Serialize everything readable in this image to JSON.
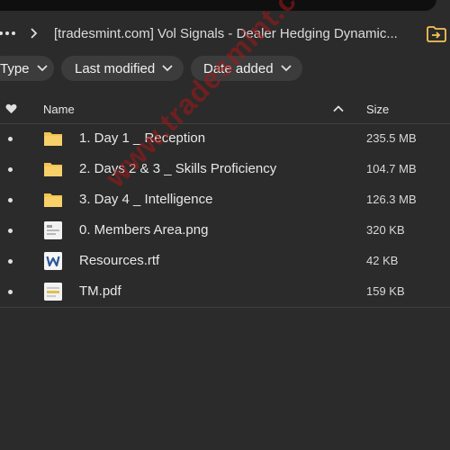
{
  "breadcrumb": {
    "title": "[tradesmint.com] Vol Signals - Dealer Hedging Dynamic..."
  },
  "filters": {
    "type_label": "Type",
    "last_modified_label": "Last modified",
    "date_added_label": "Date added"
  },
  "columns": {
    "name": "Name",
    "size": "Size"
  },
  "files": [
    {
      "name": "1. Day 1 _ Reception",
      "size": "235.5 MB",
      "icon": "folder-icon"
    },
    {
      "name": "2. Days 2 & 3 _ Skills Proficiency",
      "size": "104.7 MB",
      "icon": "folder-icon"
    },
    {
      "name": "3. Day 4 _ Intelligence",
      "size": "126.3 MB",
      "icon": "folder-icon"
    },
    {
      "name": "0. Members Area.png",
      "size": "320 KB",
      "icon": "image-file-icon"
    },
    {
      "name": "Resources.rtf",
      "size": "42 KB",
      "icon": "word-file-icon"
    },
    {
      "name": "TM.pdf",
      "size": "159 KB",
      "icon": "pdf-file-icon"
    }
  ],
  "watermark": "www.tradesmint.com",
  "colors": {
    "background": "#2b2b2b",
    "chip": "#3c3c3c",
    "folder": "#f6c453",
    "watermark": "#a31818"
  }
}
